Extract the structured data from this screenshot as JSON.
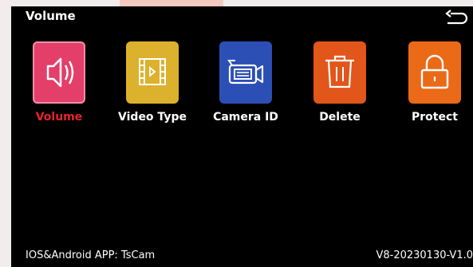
{
  "header": {
    "title": "Volume"
  },
  "menu": [
    {
      "label": "Volume",
      "icon": "speaker-icon",
      "color": "#e33f6a",
      "active": true
    },
    {
      "label": "Video Type",
      "icon": "film-play-icon",
      "color": "#dcb12d",
      "active": false
    },
    {
      "label": "Camera ID",
      "icon": "video-camera-icon",
      "color": "#2c4fb5",
      "active": false
    },
    {
      "label": "Delete",
      "icon": "trash-icon",
      "color": "#e2561b",
      "active": false
    },
    {
      "label": "Protect",
      "icon": "lock-icon",
      "color": "#ea6a18",
      "active": false
    }
  ],
  "footer": {
    "app_text": "IOS&Android APP: TsCam",
    "version": "V8-20230130-V1.0"
  },
  "colors": {
    "active_label": "#e8232e",
    "background": "#000000"
  }
}
